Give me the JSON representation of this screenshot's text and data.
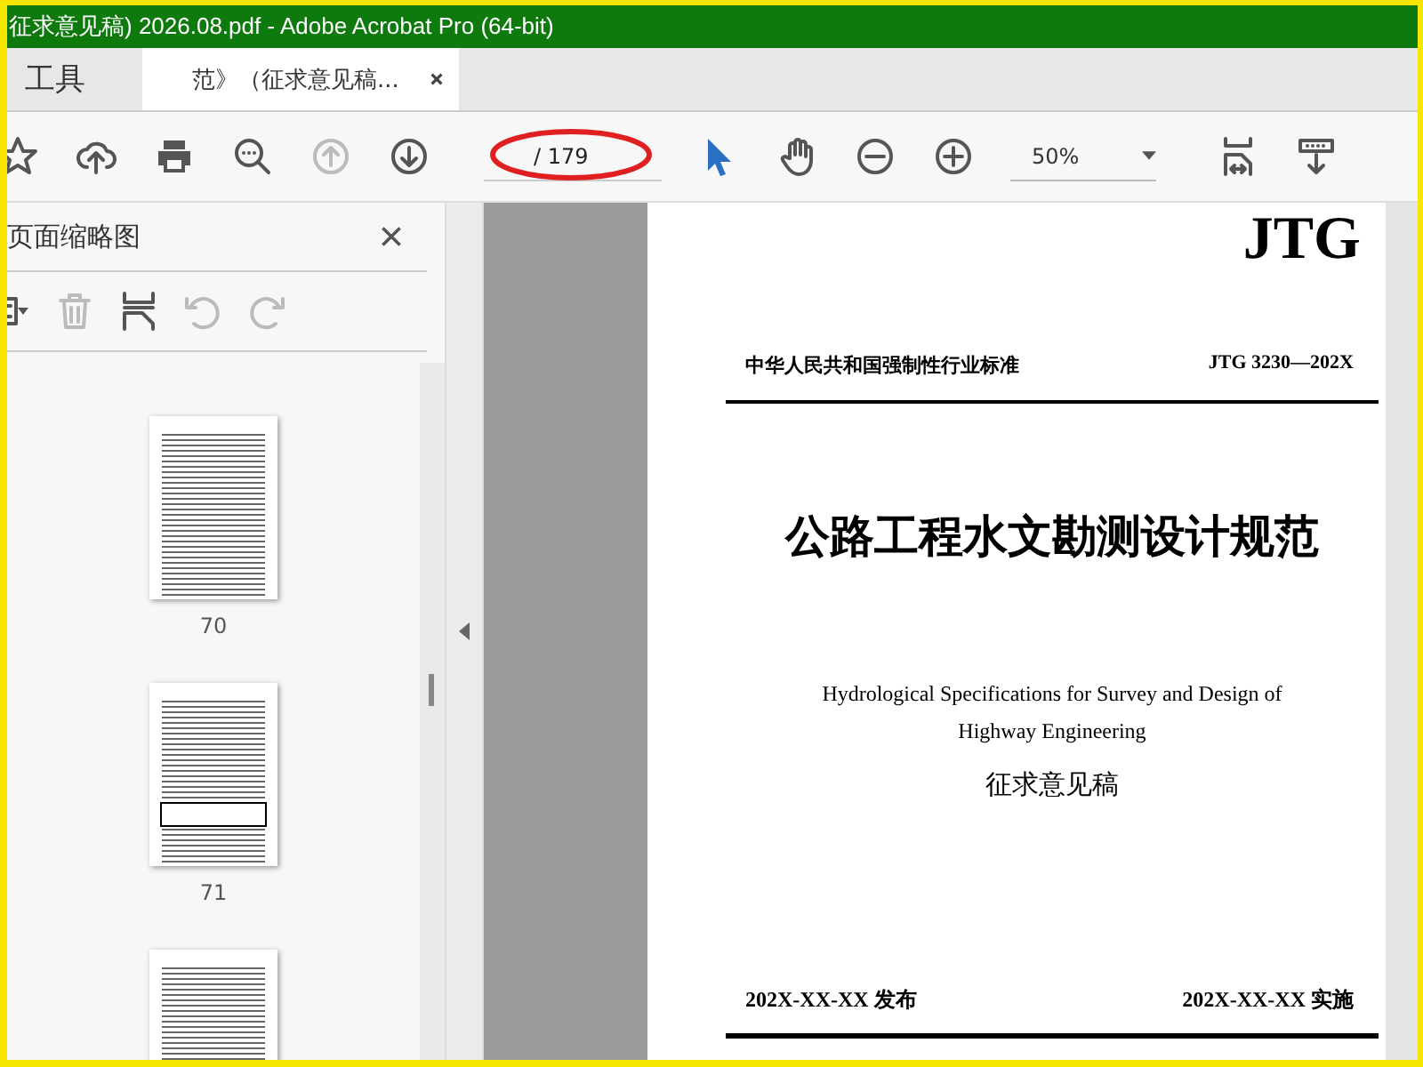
{
  "window": {
    "title": "征求意见稿) 2026.08.pdf - Adobe Acrobat Pro (64-bit)"
  },
  "tabs": [
    {
      "label": "工具",
      "selected": false,
      "closable": false
    },
    {
      "label": "范》（征求意见稿...",
      "selected": true,
      "closable": true
    }
  ],
  "toolbar": {
    "left_tools": [
      {
        "disabled": false
      },
      {
        "disabled": false
      },
      {
        "disabled": false
      },
      {
        "disabled": false
      },
      {
        "disabled": true
      },
      {
        "disabled": false
      }
    ],
    "page_count": "/ 179",
    "mid_tools": [
      {
        "selected": true
      },
      {
        "selected": false
      },
      {
        "selected": false
      },
      {
        "selected": false
      }
    ],
    "zoom": "50%",
    "right_tools": [
      {
        "disabled": false
      },
      {
        "disabled": false
      }
    ]
  },
  "sidebar": {
    "title": "页面缩略图",
    "tools": [
      {
        "disabled": false
      },
      {
        "disabled": true
      },
      {
        "disabled": false
      },
      {
        "disabled": true
      },
      {
        "disabled": true
      }
    ],
    "thumbnails": [
      {
        "label": "70",
        "kind": "text"
      },
      {
        "label": "71",
        "kind": "table"
      },
      {
        "kind": "text"
      }
    ]
  },
  "document": {
    "logo": "JTG",
    "standard_type": "中华人民共和国强制性行业标准",
    "code": "JTG 3230—202X",
    "title": "公路工程水文勘测设计规范",
    "english_title": [
      "Hydrological Specifications for Survey and Design of",
      "Highway Engineering"
    ],
    "status": "征求意见稿",
    "issue_date": "202X-XX-XX 发布",
    "effective_date": "202X-XX-XX 实施"
  }
}
